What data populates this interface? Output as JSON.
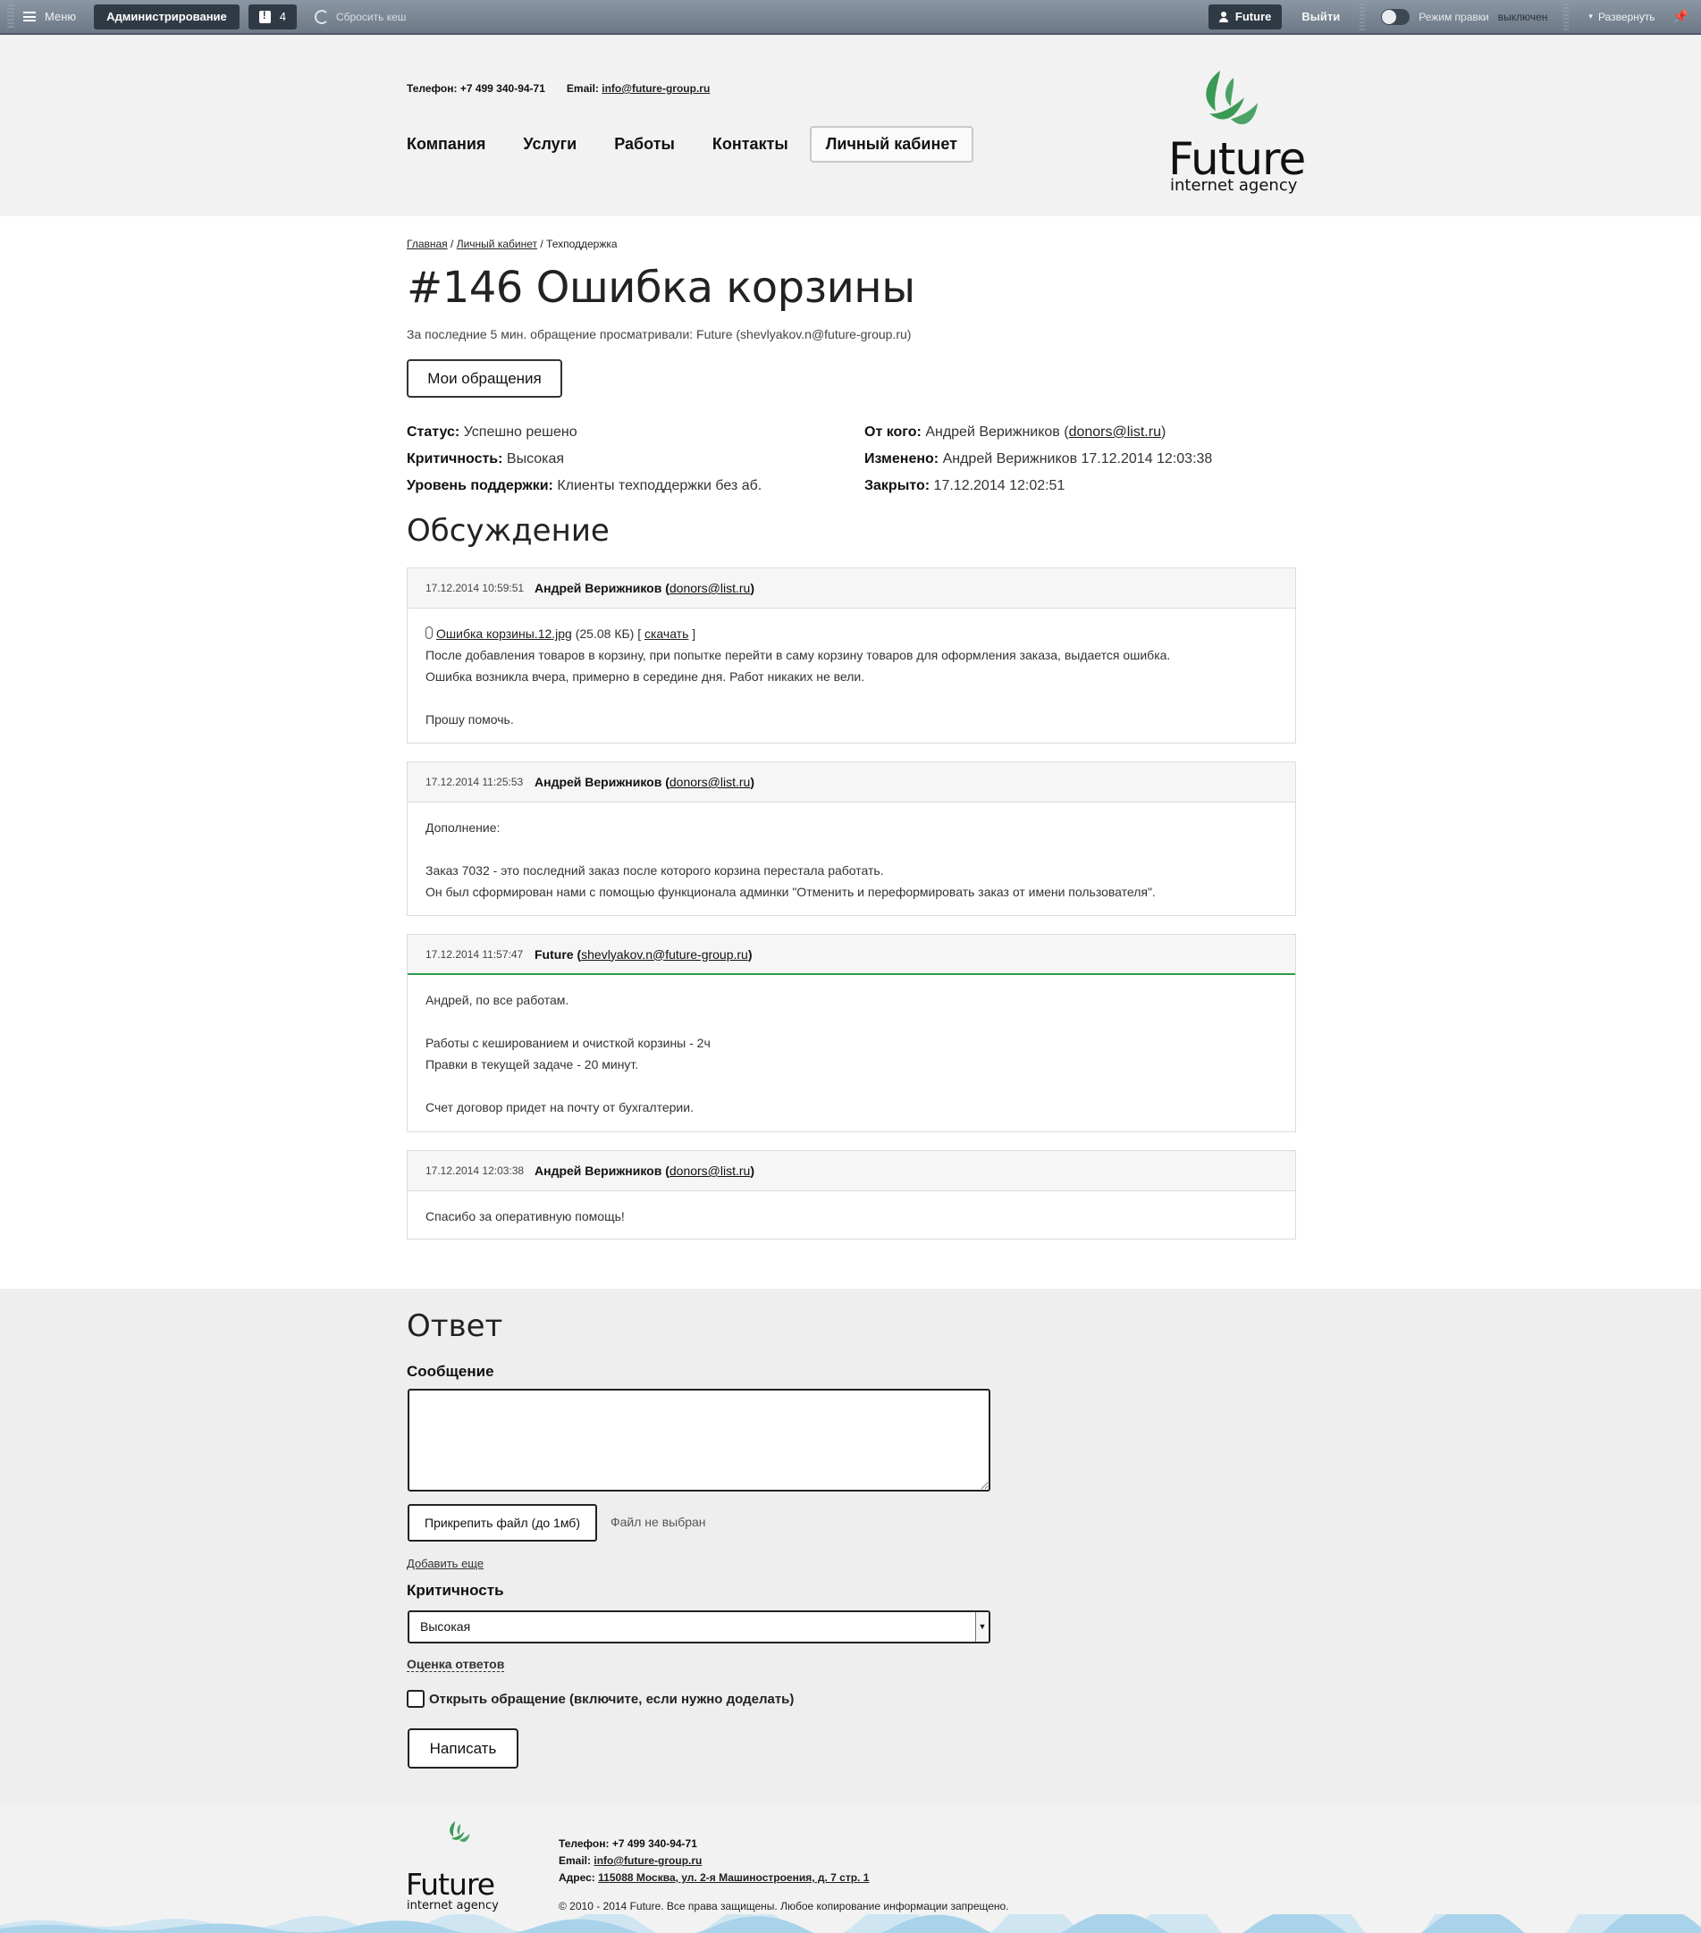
{
  "adminbar": {
    "menu_label": "Меню",
    "admin_label": "Администрирование",
    "notifications_count": "4",
    "reset_cache_label": "Сбросить кеш",
    "user_label": "Future",
    "logout_label": "Выйти",
    "edit_mode_label": "Режим правки",
    "edit_mode_state": "выключен",
    "expand_label": "Развернуть"
  },
  "header": {
    "phone_label": "Телефон:",
    "phone": "+7 499 340-94-71",
    "email_label": "Email:",
    "email": "info@future-group.ru",
    "nav": [
      "Компания",
      "Услуги",
      "Работы",
      "Контакты"
    ],
    "cabinet_label": "Личный кабинет",
    "logo_word": "Future",
    "logo_sub": "internet agency"
  },
  "breadcrumb": {
    "home": "Главная",
    "sep1": "/",
    "cabinet": "Личный кабинет",
    "sep2": "/",
    "current": "Техподдержка"
  },
  "ticket": {
    "title": "#146 Ошибка корзины",
    "viewers": "За последние 5 мин. обращение просматривали: Future (shevlyakov.n@future-group.ru)",
    "my_tickets_label": "Мои обращения",
    "status_label": "Статус:",
    "status": "Успешно решено",
    "priority_label": "Критичность:",
    "priority": "Высокая",
    "support_level_label": "Уровень поддержки:",
    "support_level": "Клиенты техподдержки без аб.",
    "from_label": "От кого:",
    "from_name": "Андрей Верижников (",
    "from_email": "donors@list.ru",
    "from_close": ")",
    "modified_label": "Изменено:",
    "modified": "Андрей Верижников 17.12.2014 12:03:38",
    "closed_label": "Закрыто:",
    "closed": "17.12.2014 12:02:51"
  },
  "discussion": {
    "heading": "Обсуждение",
    "messages": [
      {
        "date": "17.12.2014 10:59:51",
        "author": "Андрей Верижников",
        "email": "donors@list.ru",
        "attachment_name": "Ошибка корзины.12.jpg",
        "attachment_size": "(25.08 КБ)",
        "attachment_download": "скачать",
        "lines": [
          "После добавления товаров в корзину, при попытке перейти в саму корзину товаров для оформления заказа, выдается ошибка.",
          "Ошибка возникла вчера, примерно в середине дня. Работ никаких не вели.",
          "",
          "Прошу помочь."
        ]
      },
      {
        "date": "17.12.2014 11:25:53",
        "author": "Андрей Верижников",
        "email": "donors@list.ru",
        "lines": [
          "Дополнение:",
          "",
          "Заказ 7032 - это последний заказ после которого корзина перестала работать.",
          "Он был сформирован нами с помощью функционала  админки \"Отменить и переформировать заказ от имени пользователя\"."
        ]
      },
      {
        "date": "17.12.2014 11:57:47",
        "author": "Future",
        "email": "shevlyakov.n@future-group.ru",
        "lines": [
          "Андрей, по все работам.",
          "",
          "Работы с кешированием и очисткой корзины - 2ч",
          "Правки в текущей задаче - 20 минут.",
          "",
          "Счет договор придет на почту от бухгалтерии."
        ]
      },
      {
        "date": "17.12.2014 12:03:38",
        "author": "Андрей Верижников",
        "email": "donors@list.ru",
        "lines": [
          "Спасибо за оперативную помощь!"
        ]
      }
    ]
  },
  "reply": {
    "heading": "Ответ",
    "message_label": "Сообщение",
    "attach_label": "Прикрепить файл (до 1мб)",
    "no_file": "Файл не выбран",
    "add_more": "Добавить еще",
    "priority_label": "Критичность",
    "priority_value": "Высокая",
    "rating_label": "Оценка ответов",
    "reopen_label": "Открыть обращение (включите, если нужно доделать)",
    "submit_label": "Написать"
  },
  "footer": {
    "phone_label": "Телефон:",
    "phone": "+7 499 340-94-71",
    "email_label": "Email:",
    "email": "info@future-group.ru",
    "address_label": "Адрес:",
    "address": "115088 Москва, ул. 2-я Машиностроения, д. 7 стр. 1",
    "copyright": "© 2010 - 2014 Future. Все права защищены. Любое копирование информации запрещено.",
    "logo_word": "Future",
    "logo_sub": "internet agency"
  },
  "colors": {
    "brand_green": "#3a9a55",
    "adminbar": "#7b8794",
    "staff_accent": "#2e9a49"
  }
}
